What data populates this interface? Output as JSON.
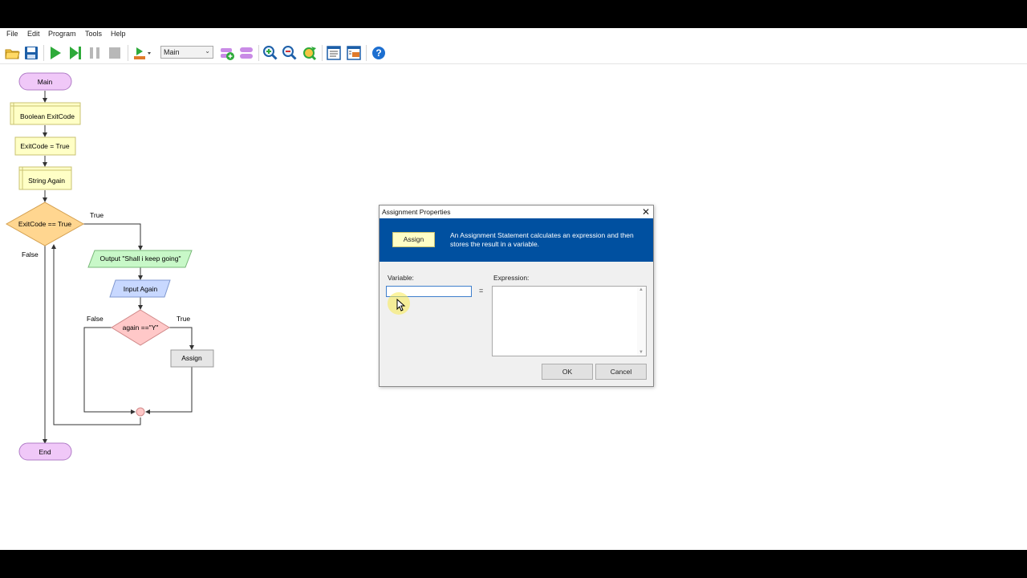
{
  "menu": [
    "File",
    "Edit",
    "Program",
    "Tools",
    "Help"
  ],
  "toolbar": {
    "subprogram_selected": "Main",
    "icons": [
      "open-folder-icon",
      "save-icon",
      "run-icon",
      "step-icon",
      "pause-icon",
      "stop-icon",
      "run-speed-icon",
      "add-function-icon",
      "manage-functions-icon",
      "zoom-in-icon",
      "zoom-out-icon",
      "zoom-fit-icon",
      "show-console-icon",
      "layout-icon",
      "help-icon"
    ]
  },
  "flowchart": {
    "start": "Main",
    "declare1": "Boolean ExitCode",
    "assign1": "ExitCode = True",
    "declare2": "String Again",
    "loop_condition": "ExitCode == True",
    "loop_true_label": "True",
    "loop_false_label": "False",
    "output1": "Output \"Shall i keep going\"",
    "input1": "Input Again",
    "if_condition": "again ==\"Y\"",
    "if_false_label": "False",
    "if_true_label": "True",
    "assign2": "Assign",
    "end": "End"
  },
  "dialog": {
    "title": "Assignment Properties",
    "close": "✕",
    "banner_shape_label": "Assign",
    "banner_text": "An Assignment Statement calculates an expression and then stores the result in a variable.",
    "variable_label": "Variable:",
    "variable_value": "",
    "equals": "=",
    "expression_label": "Expression:",
    "expression_value": "",
    "ok_label": "OK",
    "cancel_label": "Cancel"
  },
  "colors": {
    "banner": "#0050a0",
    "terminal_fill": "#f0c8f8",
    "declare_fill": "#ffffc6",
    "decision_loop_fill": "#ffd690",
    "output_fill": "#c8f8c8",
    "input_fill": "#c8d8ff",
    "decision_if_fill": "#ffc8c8",
    "assign_fill": "#e6e6e6"
  }
}
